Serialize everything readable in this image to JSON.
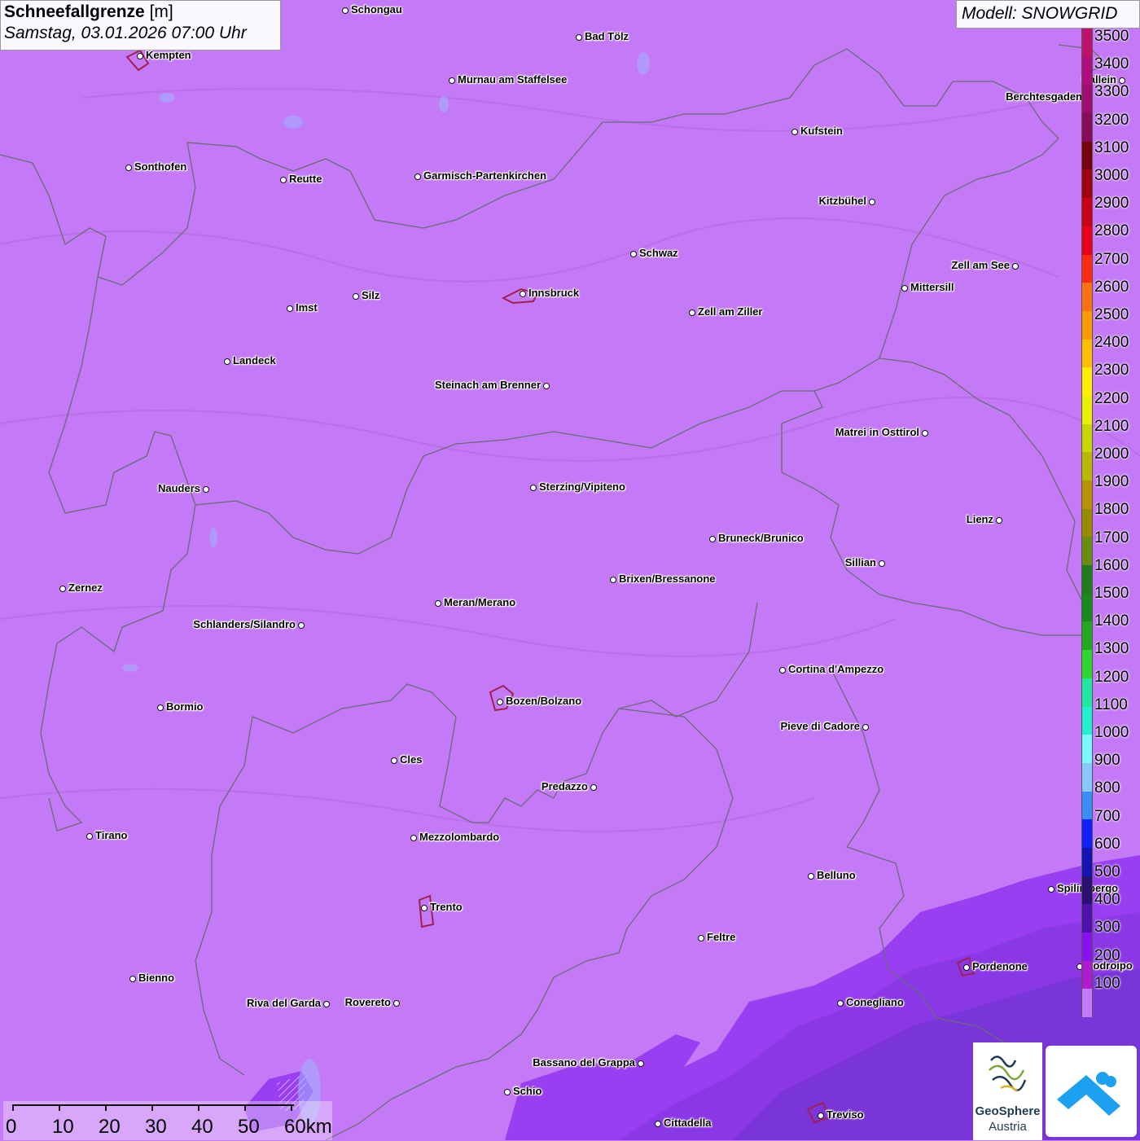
{
  "header": {
    "title_bold": "Schneefallgrenze",
    "title_unit": "[m]",
    "datetime": "Samstag, 03.01.2026 07:00 Uhr"
  },
  "model_label": "Modell: SNOWGRID",
  "legend": {
    "levels": [
      {
        "value": "3500",
        "color": "#c0106e"
      },
      {
        "value": "3400",
        "color": "#b00d80"
      },
      {
        "value": "3300",
        "color": "#a00d70"
      },
      {
        "value": "3200",
        "color": "#8a0a5a"
      },
      {
        "value": "3100",
        "color": "#7a0010"
      },
      {
        "value": "3000",
        "color": "#a00010"
      },
      {
        "value": "2900",
        "color": "#c80018"
      },
      {
        "value": "2800",
        "color": "#e8001e"
      },
      {
        "value": "2700",
        "color": "#ff2a10"
      },
      {
        "value": "2600",
        "color": "#ff7010"
      },
      {
        "value": "2500",
        "color": "#ff9a00"
      },
      {
        "value": "2400",
        "color": "#ffbe00"
      },
      {
        "value": "2300",
        "color": "#ffee00"
      },
      {
        "value": "2200",
        "color": "#e6f200"
      },
      {
        "value": "2100",
        "color": "#c6d800"
      },
      {
        "value": "2000",
        "color": "#b8b800"
      },
      {
        "value": "1900",
        "color": "#b89200"
      },
      {
        "value": "1800",
        "color": "#9a8a00"
      },
      {
        "value": "1700",
        "color": "#6a8c10"
      },
      {
        "value": "1600",
        "color": "#1f7a20"
      },
      {
        "value": "1500",
        "color": "#1a8a20"
      },
      {
        "value": "1400",
        "color": "#22a820"
      },
      {
        "value": "1300",
        "color": "#2cd830"
      },
      {
        "value": "1200",
        "color": "#20e8a0"
      },
      {
        "value": "1100",
        "color": "#20f0d0"
      },
      {
        "value": "1000",
        "color": "#7afaff"
      },
      {
        "value": "900",
        "color": "#88c8ff"
      },
      {
        "value": "800",
        "color": "#3a8cf8"
      },
      {
        "value": "700",
        "color": "#1020ff"
      },
      {
        "value": "600",
        "color": "#1414b4"
      },
      {
        "value": "500",
        "color": "#2a1070"
      },
      {
        "value": "400",
        "color": "#5010b0"
      },
      {
        "value": "300",
        "color": "#8a10f0"
      },
      {
        "value": "200",
        "color": "#b01ad0"
      },
      {
        "value": "100",
        "color": "#c479f7"
      }
    ]
  },
  "colors": {
    "map_base": "#c479f7",
    "low_zone": "#9a3ef2",
    "lowest_zone": "#7a35d8",
    "city_outline": "#a02050",
    "border": "#6a6a78"
  },
  "cities": [
    {
      "name": "Schongau",
      "side": "r"
    },
    {
      "name": "Bad Tölz",
      "side": "r"
    },
    {
      "name": "Kempten",
      "side": "r"
    },
    {
      "name": "Murnau am Staffelsee",
      "side": "r"
    },
    {
      "name": "Hallein",
      "side": "l"
    },
    {
      "name": "Berchtesgaden",
      "side": "l"
    },
    {
      "name": "Kufstein",
      "side": "r"
    },
    {
      "name": "Sonthofen",
      "side": "r"
    },
    {
      "name": "Reutte",
      "side": "r"
    },
    {
      "name": "Garmisch-Partenkirchen",
      "side": "r"
    },
    {
      "name": "Kitzbühel",
      "side": "l"
    },
    {
      "name": "Schwaz",
      "side": "r"
    },
    {
      "name": "Zell am See",
      "side": "l"
    },
    {
      "name": "Mittersill",
      "side": "r"
    },
    {
      "name": "Innsbruck",
      "side": "r"
    },
    {
      "name": "Silz",
      "side": "r"
    },
    {
      "name": "Imst",
      "side": "r"
    },
    {
      "name": "Zell am Ziller",
      "side": "r"
    },
    {
      "name": "Landeck",
      "side": "r"
    },
    {
      "name": "Steinach am Brenner",
      "side": "l"
    },
    {
      "name": "Matrei in Osttirol",
      "side": "l"
    },
    {
      "name": "Nauders",
      "side": "l"
    },
    {
      "name": "Sterzing/Vipiteno",
      "side": "r"
    },
    {
      "name": "Lienz",
      "side": "l"
    },
    {
      "name": "Bruneck/Brunico",
      "side": "r"
    },
    {
      "name": "Sillian",
      "side": "l"
    },
    {
      "name": "Zernez",
      "side": "r"
    },
    {
      "name": "Brixen/Bressanone",
      "side": "r"
    },
    {
      "name": "Meran/Merano",
      "side": "r"
    },
    {
      "name": "Schlanders/Silandro",
      "side": "l"
    },
    {
      "name": "Cortina d'Ampezzo",
      "side": "r"
    },
    {
      "name": "Bozen/Bolzano",
      "side": "r"
    },
    {
      "name": "Bormio",
      "side": "r"
    },
    {
      "name": "Pieve di Cadore",
      "side": "l"
    },
    {
      "name": "Cles",
      "side": "r"
    },
    {
      "name": "Predazzo",
      "side": "l"
    },
    {
      "name": "Tirano",
      "side": "r"
    },
    {
      "name": "Mezzolombardo",
      "side": "r"
    },
    {
      "name": "Belluno",
      "side": "r"
    },
    {
      "name": "Spilimbergo",
      "side": "r"
    },
    {
      "name": "Trento",
      "side": "r"
    },
    {
      "name": "Feltre",
      "side": "r"
    },
    {
      "name": "Pordenone",
      "side": "r"
    },
    {
      "name": "Codroipo",
      "side": "r"
    },
    {
      "name": "Bienno",
      "side": "r"
    },
    {
      "name": "Riva del Garda",
      "side": "l"
    },
    {
      "name": "Rovereto",
      "side": "l"
    },
    {
      "name": "Conegliano",
      "side": "r"
    },
    {
      "name": "Bassano del Grappa",
      "side": "l"
    },
    {
      "name": "Schio",
      "side": "r"
    },
    {
      "name": "Treviso",
      "side": "r"
    },
    {
      "name": "Cittadella",
      "side": "r"
    }
  ],
  "scale": {
    "ticks": [
      "0",
      "10",
      "20",
      "30",
      "40",
      "50",
      "60km"
    ]
  },
  "logos": {
    "geosphere_line1": "GeoSphere",
    "geosphere_line2": "Austria"
  }
}
